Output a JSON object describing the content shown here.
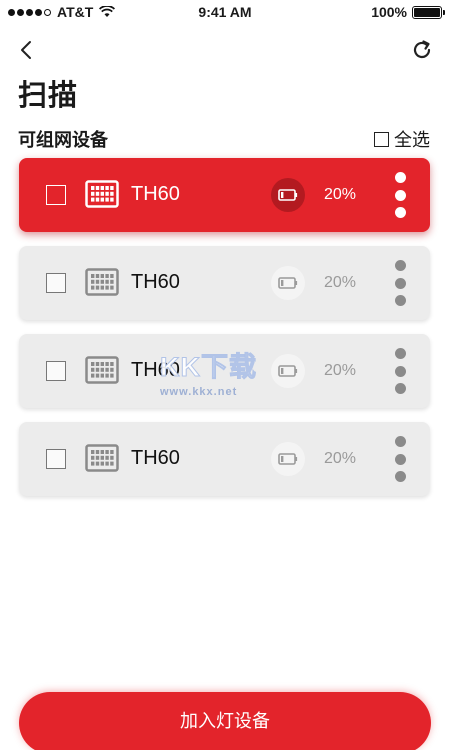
{
  "status_bar": {
    "carrier": "AT&T",
    "time": "9:41 AM",
    "battery": "100%",
    "battery_level": 1.0
  },
  "header": {
    "title": "扫描",
    "back_icon": "chevron-left-icon",
    "refresh_icon": "refresh-icon"
  },
  "section": {
    "title": "可组网设备",
    "select_all_label": "全选"
  },
  "devices": [
    {
      "name": "TH60",
      "battery": "20%",
      "selected": true
    },
    {
      "name": "TH60",
      "battery": "20%",
      "selected": false
    },
    {
      "name": "TH60",
      "battery": "20%",
      "selected": false
    },
    {
      "name": "TH60",
      "battery": "20%",
      "selected": false
    }
  ],
  "watermark": {
    "text": "KK下载",
    "url": "www.kkx.net"
  },
  "footer": {
    "add_button_label": "加入灯设备"
  },
  "colors": {
    "accent": "#e3242b",
    "card_bg": "#ececec",
    "muted_text": "#9a9a9a"
  }
}
